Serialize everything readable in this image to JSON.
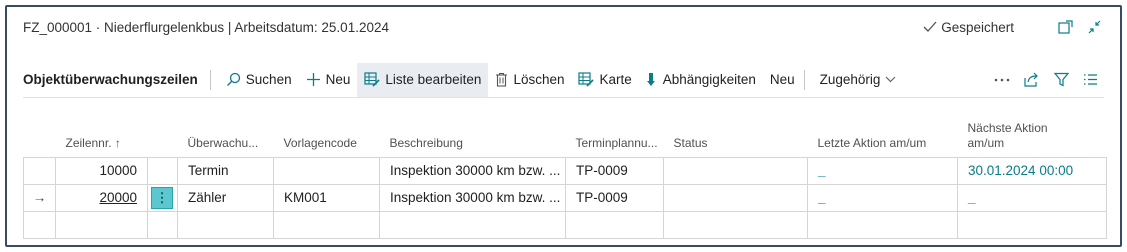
{
  "header": {
    "title": "FZ_000001 · Niederflurgelenkbus | Arbeitsdatum: 25.01.2024",
    "saved_label": "Gespeichert"
  },
  "toolbar": {
    "section_title": "Objektüberwachungszeilen",
    "search": "Suchen",
    "new": "Neu",
    "edit_list": "Liste bearbeiten",
    "delete": "Löschen",
    "card": "Karte",
    "dependencies": "Abhängigkeiten",
    "new2": "Neu",
    "related": "Zugehörig"
  },
  "table": {
    "headers": {
      "line_no": "Zeilennr. ↑",
      "monitoring": "Überwachu...",
      "template": "Vorlagencode",
      "description": "Beschreibung",
      "scheduling": "Terminplannu...",
      "status": "Status",
      "last_action": "Letzte Aktion am/um",
      "next_action_1": "Nächste Aktion",
      "next_action_2": "am/um"
    },
    "rows": [
      {
        "line_no": "10000",
        "monitoring": "Termin",
        "template": "",
        "description": "Inspektion 30000 km bzw. ...",
        "scheduling": "TP-0009",
        "status": "",
        "last_action": "_",
        "next_action": "30.01.2024 00:00"
      },
      {
        "line_no": "20000",
        "monitoring": "Zähler",
        "template": "KM001",
        "description": "Inspektion 30000 km bzw. ...",
        "scheduling": "TP-0009",
        "status": "",
        "last_action": "_",
        "next_action": "_"
      }
    ]
  },
  "colors": {
    "accent": "#0a7c8a",
    "selected_cell": "#5bc8d0",
    "frame": "#3b4a63"
  }
}
